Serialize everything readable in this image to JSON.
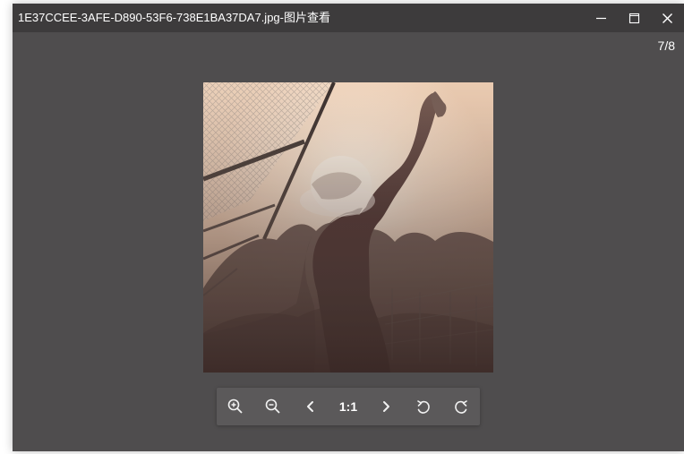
{
  "window": {
    "title": "1E37CCEE-3AFE-D890-53F6-738E1BA37DA7.jpg-图片查看",
    "counter": "7/8"
  },
  "window_controls": {
    "minimize_icon": "minimize-icon",
    "maximize_icon": "maximize-icon",
    "close_icon": "close-icon"
  },
  "toolbar": {
    "ratio_label": "1:1",
    "icons": [
      "zoom-in-icon",
      "zoom-out-icon",
      "previous-icon",
      "next-icon",
      "rotate-left-icon",
      "rotate-right-icon"
    ]
  },
  "colors": {
    "window_background": "#4f4d4e",
    "titlebar_background": "#3d3b3c",
    "toolbar_background": "#5b595a",
    "text": "#ffffff"
  }
}
